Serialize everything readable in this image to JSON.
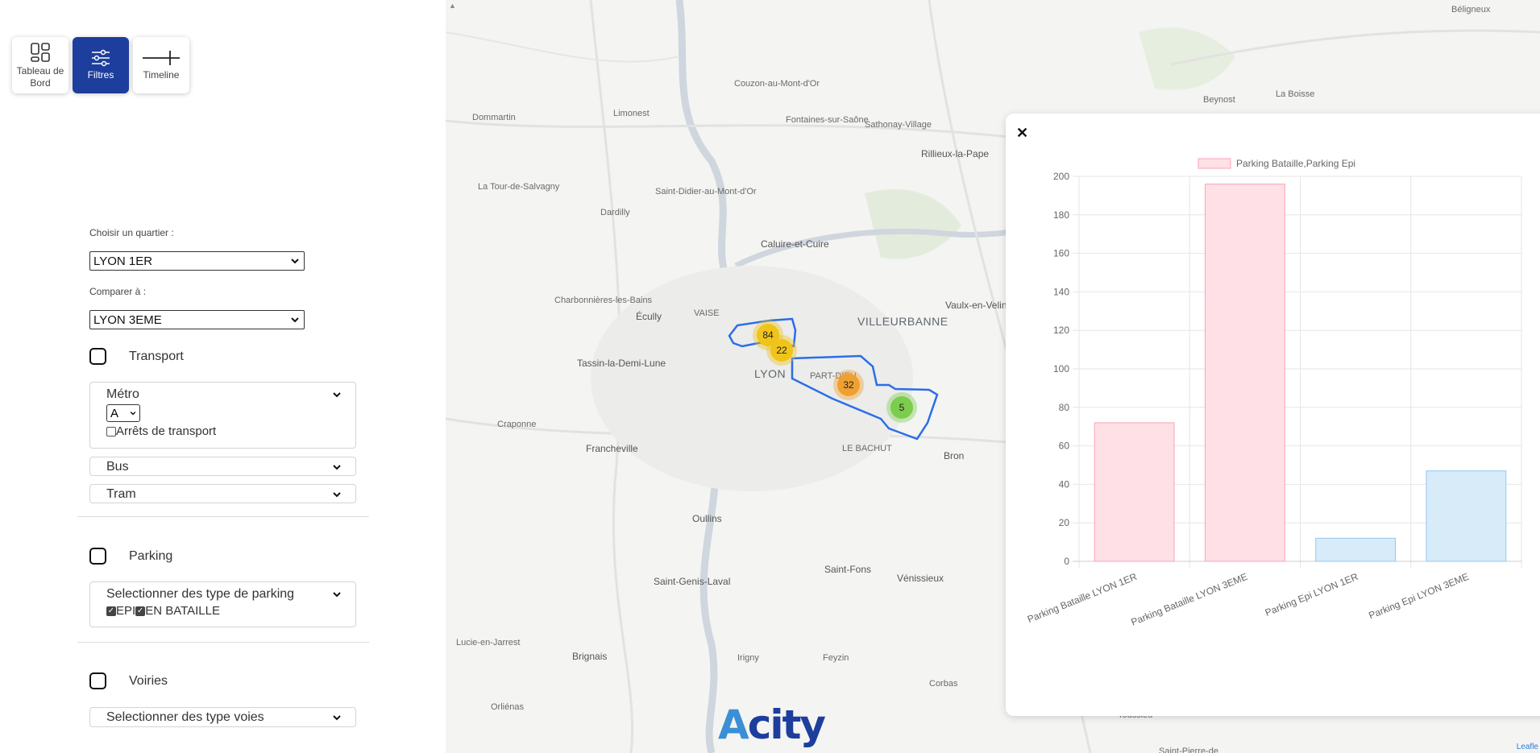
{
  "nav": {
    "dashboard_label": "Tableau de Bord",
    "filters_label": "Filtres",
    "timeline_label": "Timeline"
  },
  "filters": {
    "district_label": "Choisir un quartier :",
    "district_value": "LYON 1ER",
    "compare_label": "Comparer à :",
    "compare_value": "LYON 3EME",
    "transport": {
      "label": "Transport",
      "metro_label": "Métro",
      "metro_line": "A",
      "stops_label": "Arrêts de transport",
      "bus_label": "Bus",
      "tram_label": "Tram"
    },
    "parking": {
      "label": "Parking",
      "select_label": "Selectionner des type de parking",
      "option_epi": "EPI",
      "option_bataille": "EN BATAILLE"
    },
    "roads": {
      "label": "Voiries",
      "select_label": "Selectionner des type voies"
    }
  },
  "map": {
    "places": [
      {
        "name": "Béligneux",
        "cls": ""
      },
      {
        "name": "Beynost",
        "cls": ""
      },
      {
        "name": "La Boisse",
        "cls": ""
      },
      {
        "name": "Dommartin",
        "cls": ""
      },
      {
        "name": "Limonest",
        "cls": ""
      },
      {
        "name": "Couzon-au-Mont-d'Or",
        "cls": ""
      },
      {
        "name": "Fontaines-sur-Saône",
        "cls": ""
      },
      {
        "name": "Sathonay-Village",
        "cls": ""
      },
      {
        "name": "Rillieux-la-Pape",
        "cls": "med"
      },
      {
        "name": "La Tour-de-Salvagny",
        "cls": ""
      },
      {
        "name": "Saint-Didier-au-Mont-d'Or",
        "cls": ""
      },
      {
        "name": "Dardilly",
        "cls": ""
      },
      {
        "name": "Caluire-et-Cuire",
        "cls": "med"
      },
      {
        "name": "Charbonnières-les-Bains",
        "cls": ""
      },
      {
        "name": "Écully",
        "cls": "med"
      },
      {
        "name": "VAISE",
        "cls": ""
      },
      {
        "name": "VILLEURBANNE",
        "cls": "big"
      },
      {
        "name": "Vaulx-en-Velin",
        "cls": "med"
      },
      {
        "name": "Tassin-la-Demi-Lune",
        "cls": "med"
      },
      {
        "name": "LYON",
        "cls": "big"
      },
      {
        "name": "PART-DIEU",
        "cls": ""
      },
      {
        "name": "Craponne",
        "cls": ""
      },
      {
        "name": "Francheville",
        "cls": "med"
      },
      {
        "name": "LE BACHUT",
        "cls": ""
      },
      {
        "name": "Bron",
        "cls": "med"
      },
      {
        "name": "Oullins",
        "cls": "med"
      },
      {
        "name": "Saint-Fons",
        "cls": "med"
      },
      {
        "name": "Saint-Genis-Laval",
        "cls": "med"
      },
      {
        "name": "Vénissieux",
        "cls": "med"
      },
      {
        "name": "Lucie-en-Jarrest",
        "cls": ""
      },
      {
        "name": "Brignais",
        "cls": "med"
      },
      {
        "name": "Irigny",
        "cls": ""
      },
      {
        "name": "Feyzin",
        "cls": ""
      },
      {
        "name": "Corbas",
        "cls": ""
      },
      {
        "name": "Orliénas",
        "cls": ""
      },
      {
        "name": "Toussieu",
        "cls": ""
      },
      {
        "name": "Saint-Pierre-de",
        "cls": ""
      }
    ],
    "clusters": [
      {
        "count": "84",
        "color": "#f0c419"
      },
      {
        "count": "22",
        "color": "#f0c419"
      },
      {
        "count": "32",
        "color": "#f0a030"
      },
      {
        "count": "5",
        "color": "#7ccc4e"
      }
    ],
    "logo_text": "city",
    "logo_mark": "A",
    "attribution": "Leafle"
  },
  "chart_data": {
    "type": "bar",
    "legend": "Parking Bataille,Parking Epi",
    "categories": [
      "Parking Bataille LYON 1ER",
      "Parking Bataille LYON 3EME",
      "Parking Epi LYON 1ER",
      "Parking Epi LYON 3EME"
    ],
    "values": [
      72,
      196,
      12,
      47
    ],
    "colors": [
      "#ffe0e6",
      "#ffe0e6",
      "#d8ebf9",
      "#d8ebf9"
    ],
    "border_colors": [
      "#f8a5b5",
      "#f8a5b5",
      "#95c7ee",
      "#95c7ee"
    ],
    "ylim": [
      0,
      200
    ],
    "yticks": [
      0,
      20,
      40,
      60,
      80,
      100,
      120,
      140,
      160,
      180,
      200
    ],
    "grid": true,
    "legend_position": "top"
  },
  "modal": {
    "close_glyph": "✕"
  }
}
